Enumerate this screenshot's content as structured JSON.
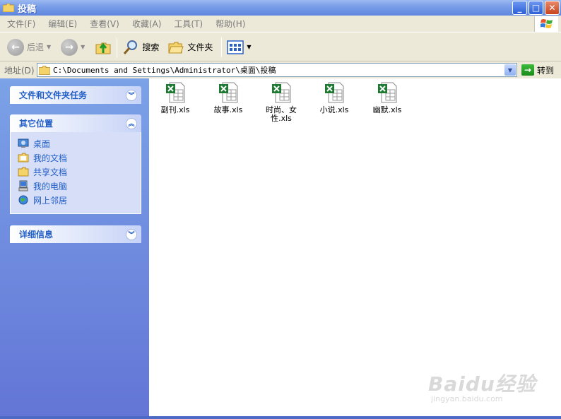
{
  "window": {
    "title": "投稿"
  },
  "menu": [
    "文件(F)",
    "编辑(E)",
    "查看(V)",
    "收藏(A)",
    "工具(T)",
    "帮助(H)"
  ],
  "toolbar": {
    "back_label": "后退",
    "search_label": "搜索",
    "folders_label": "文件夹"
  },
  "address": {
    "label": "地址(D)",
    "value": "C:\\Documents and Settings\\Administrator\\桌面\\投稿",
    "go_label": "转到"
  },
  "leftpane": {
    "tasks_title": "文件和文件夹任务",
    "places_title": "其它位置",
    "places": [
      "桌面",
      "我的文档",
      "共享文档",
      "我的电脑",
      "网上邻居"
    ],
    "details_title": "详细信息"
  },
  "files": [
    {
      "name": "副刊.xls"
    },
    {
      "name": "故事.xls"
    },
    {
      "name": "时尚、女性.xls"
    },
    {
      "name": "小说.xls"
    },
    {
      "name": "幽默.xls"
    }
  ],
  "watermark": {
    "brand": "Baidu经验",
    "url": "jingyan.baidu.com"
  },
  "colors": {
    "titlebar": "#5f86de",
    "link": "#215dc6",
    "pane": "#6375d6",
    "excel_green": "#1e7a32"
  }
}
